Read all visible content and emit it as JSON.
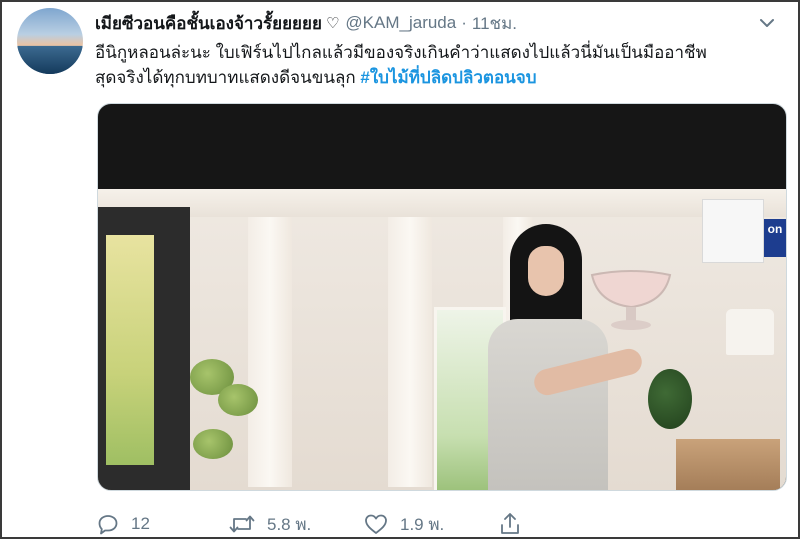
{
  "tweet": {
    "display_name": "เมียซีวอนคือชั้นเองจ้าวรั้ยยยยย",
    "handle": "@KAM_jaruda",
    "separator": "·",
    "time": "11ชม.",
    "text_line_1": "อีนิกูหลอนล่ะนะ ใบเฟิร์นไปไกลแล้วมีของจริงเกินคำว่าแสดงไปแล้วนี่มันเป็นมืออาชีพ",
    "text_line_2_plain": "สุดจริงได้ทุกบทบาทแสดงดีจนขนลุก ",
    "hashtag": "#ใบไม้ที่ปลิดปลิวตอนจบ",
    "media": {
      "tv_logo": "on"
    },
    "actions": {
      "reply_count": "12",
      "retweet_count": "5.8 พ.",
      "like_count": "1.9 พ."
    }
  },
  "icons": {
    "name_suffix": "heart-outline-icon",
    "menu": "chevron-down-icon",
    "reply": "reply-icon",
    "retweet": "retweet-icon",
    "like": "like-icon",
    "share": "share-icon"
  },
  "colors": {
    "name": "#14171a",
    "secondary": "#657786",
    "hashtag": "#1b95e0"
  }
}
